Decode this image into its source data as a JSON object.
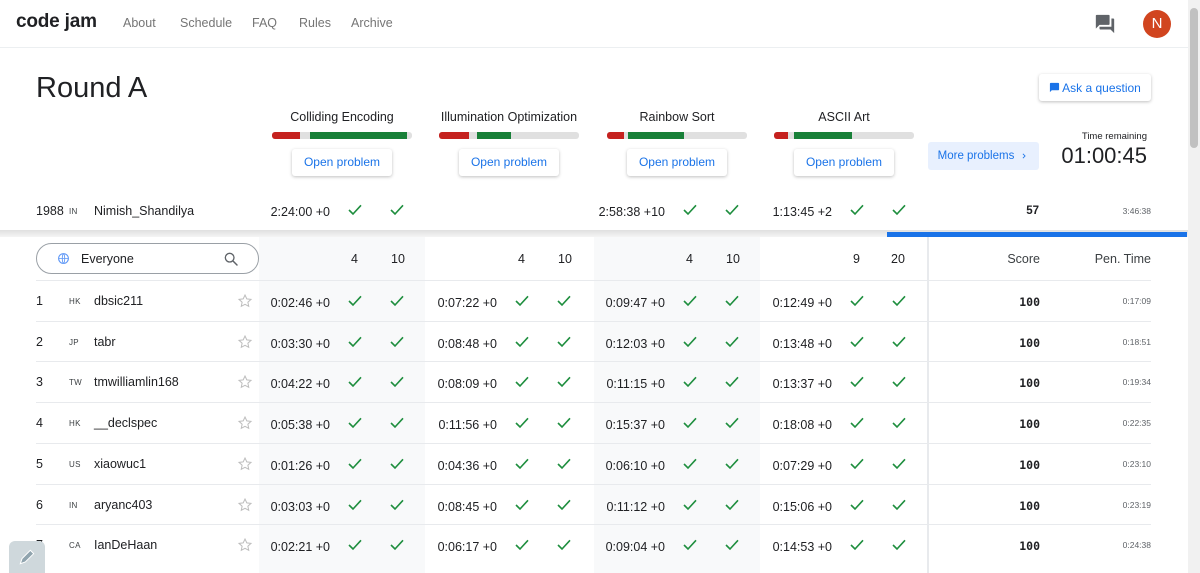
{
  "app": {
    "logo": "code jam",
    "avatar_letter": "N"
  },
  "nav": [
    "About",
    "Schedule",
    "FAQ",
    "Rules",
    "Archive"
  ],
  "round_title": "Round A",
  "ask_question": "Ask a question",
  "problems": [
    {
      "title": "Colliding Encoding",
      "max_points": "4",
      "max_points2": "10"
    },
    {
      "title": "Illumination Optimization",
      "max_points": "4",
      "max_points2": "10"
    },
    {
      "title": "Rainbow Sort",
      "max_points": "4",
      "max_points2": "10"
    },
    {
      "title": "ASCII Art",
      "max_points": "9",
      "max_points2": "20"
    }
  ],
  "open_problem_label": "Open problem",
  "more_problems": "More problems",
  "time_remaining_label": "Time remaining",
  "time_remaining": "01:00:45",
  "my_row": {
    "rank": "1988",
    "country": "IN",
    "name": "Nimish_Shandilya",
    "times": [
      "2:24:00 +0",
      "",
      "2:58:38 +10",
      "1:13:45 +2"
    ],
    "score": "57",
    "penalty": "3:46:38"
  },
  "filter": {
    "label": "Everyone"
  },
  "headers": {
    "score": "Score",
    "penalty": "Pen. Time"
  },
  "rows": [
    {
      "rank": "1",
      "country": "HK",
      "name": "dbsic211",
      "times": [
        "0:02:46 +0",
        "0:07:22 +0",
        "0:09:47 +0",
        "0:12:49 +0"
      ],
      "score": "100",
      "penalty": "0:17:09"
    },
    {
      "rank": "2",
      "country": "JP",
      "name": "tabr",
      "times": [
        "0:03:30 +0",
        "0:08:48 +0",
        "0:12:03 +0",
        "0:13:48 +0"
      ],
      "score": "100",
      "penalty": "0:18:51"
    },
    {
      "rank": "3",
      "country": "TW",
      "name": "tmwilliamlin168",
      "times": [
        "0:04:22 +0",
        "0:08:09 +0",
        "0:11:15 +0",
        "0:13:37 +0"
      ],
      "score": "100",
      "penalty": "0:19:34"
    },
    {
      "rank": "4",
      "country": "HK",
      "name": "__declspec",
      "times": [
        "0:05:38 +0",
        "0:11:56 +0",
        "0:15:37 +0",
        "0:18:08 +0"
      ],
      "score": "100",
      "penalty": "0:22:35"
    },
    {
      "rank": "5",
      "country": "US",
      "name": "xiaowuc1",
      "times": [
        "0:01:26 +0",
        "0:04:36 +0",
        "0:06:10 +0",
        "0:07:29 +0"
      ],
      "score": "100",
      "penalty": "0:23:10"
    },
    {
      "rank": "6",
      "country": "IN",
      "name": "aryanc403",
      "times": [
        "0:03:03 +0",
        "0:08:45 +0",
        "0:11:12 +0",
        "0:15:06 +0"
      ],
      "score": "100",
      "penalty": "0:23:19"
    },
    {
      "rank": "7",
      "country": "CA",
      "name": "IanDeHaan",
      "times": [
        "0:02:21 +0",
        "0:06:17 +0",
        "0:09:04 +0",
        "0:14:53 +0"
      ],
      "score": "100",
      "penalty": "0:24:38"
    }
  ],
  "colors": {
    "accent": "#1a73e8",
    "check": "#1e8e3e",
    "bar_red": "#c5221f",
    "bar_green": "#188038",
    "avatar": "#d1451f"
  },
  "icons": [
    "chat-icon",
    "globe-icon",
    "search-icon",
    "star-icon",
    "check-icon",
    "chevron-right-icon",
    "feedback-icon"
  ]
}
